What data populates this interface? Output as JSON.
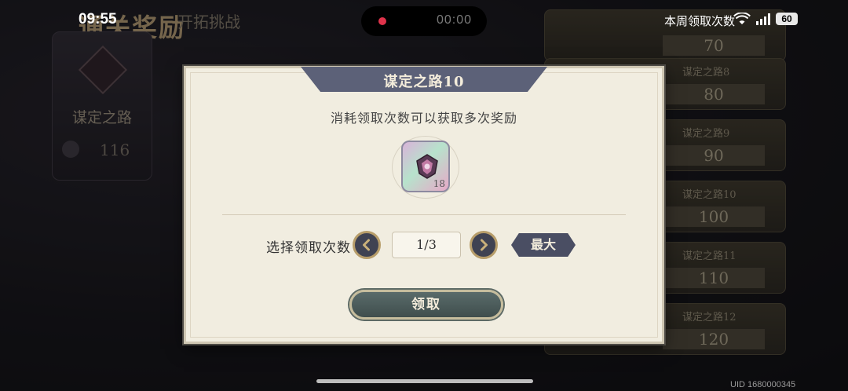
{
  "background": {
    "header_title": "通关奖励",
    "header_tab": "开拓挑战",
    "left_card": {
      "name": "谋定之路",
      "count": "116"
    },
    "list": [
      {
        "name": "",
        "value": "70"
      },
      {
        "name": "谋定之路8",
        "value": "80"
      },
      {
        "name": "谋定之路9",
        "value": "90"
      },
      {
        "name": "谋定之路10",
        "value": "100"
      },
      {
        "name": "谋定之路11",
        "value": "110"
      },
      {
        "name": "谋定之路12",
        "value": "120"
      }
    ]
  },
  "status_bar": {
    "time": "09:55",
    "recording_timer": "00:00",
    "weekly_label": "本周领取次数",
    "battery": "60",
    "network": "5G"
  },
  "dialog": {
    "title": "谋定之路10",
    "description": "消耗领取次数可以获取多次奖励",
    "reward": {
      "icon": "emblem-icon",
      "quantity": "18"
    },
    "select_label": "选择领取次数",
    "count_value": "1/3",
    "max_label": "最大",
    "claim_label": "领取"
  },
  "footer": {
    "uid": "UID 1680000345"
  },
  "colors": {
    "dialog_bg": "#f1ede0",
    "ribbon": "#5c6178",
    "claim_button": "#4a5b5a",
    "accent_gold": "#b79d6a"
  }
}
